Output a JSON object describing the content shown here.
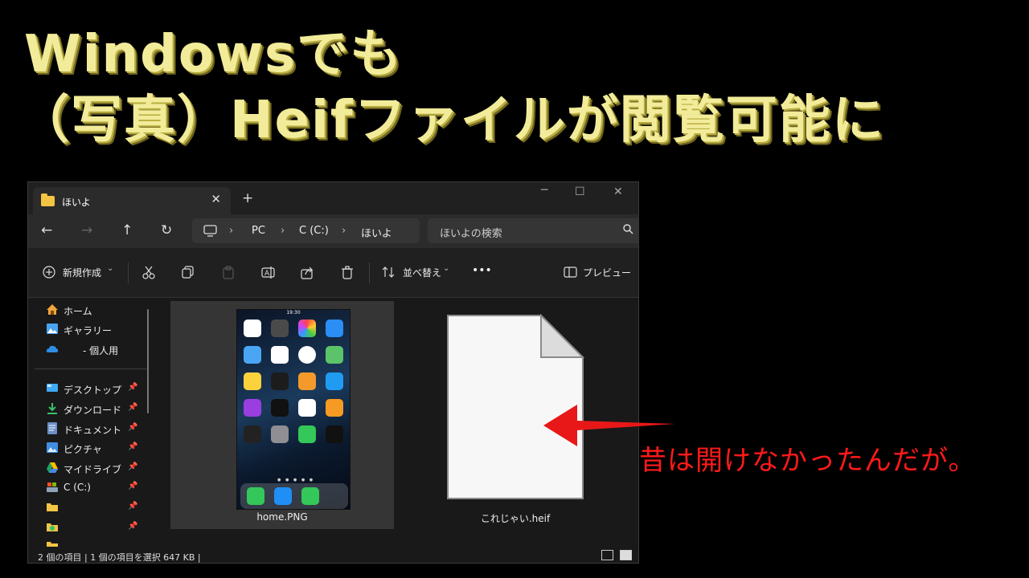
{
  "headline": {
    "line1": "Windowsでも",
    "line2": "（写真）Heifファイルが閲覧可能に"
  },
  "window": {
    "tab_label": "ほいよ",
    "tab_close": "✕",
    "new_tab": "+",
    "minimize": "─",
    "maximize": "☐",
    "close": "✕"
  },
  "nav": {
    "back": "←",
    "forward": "→",
    "up": "↑",
    "refresh": "↻",
    "breadcrumb": [
      "PC",
      "C (C:)",
      "ほいよ"
    ],
    "separator": "›",
    "search_placeholder": "ほいよの検索"
  },
  "toolbar": {
    "new_label": "新規作成",
    "sort_label": "並べ替え",
    "more": "•••",
    "preview_label": "プレビュー"
  },
  "sidebar": {
    "quick": [
      {
        "label": "ホーム",
        "icon": "home-icon"
      },
      {
        "label": "ギャラリー",
        "icon": "gallery-icon"
      },
      {
        "label": "- 個人用",
        "icon": "onedrive-icon"
      }
    ],
    "pinned": [
      {
        "label": "デスクトップ",
        "icon": "desktop-icon"
      },
      {
        "label": "ダウンロード",
        "icon": "download-icon"
      },
      {
        "label": "ドキュメント",
        "icon": "document-icon"
      },
      {
        "label": "ピクチャ",
        "icon": "pictures-icon"
      },
      {
        "label": "マイドライブ",
        "icon": "google-drive-icon"
      },
      {
        "label": "C (C:)",
        "icon": "drive-icon"
      },
      {
        "label": "",
        "icon": "folder-icon"
      },
      {
        "label": "",
        "icon": "folder-icon"
      },
      {
        "label": "",
        "icon": "folder-icon"
      }
    ]
  },
  "files": [
    {
      "name": "home.PNG",
      "selected": true
    },
    {
      "name": "これじゃい.heif",
      "selected": false
    }
  ],
  "phone_status_time": "19:30",
  "status": {
    "text": "2 個の項目  |  1 個の項目を選択  647 KB  |"
  },
  "annotation": {
    "text": "昔は開けなかったんだが。",
    "color": "#ff1a1a"
  },
  "colors": {
    "headline": "#f2ec9a",
    "folder": "#f4c443",
    "selection": "#353535"
  }
}
